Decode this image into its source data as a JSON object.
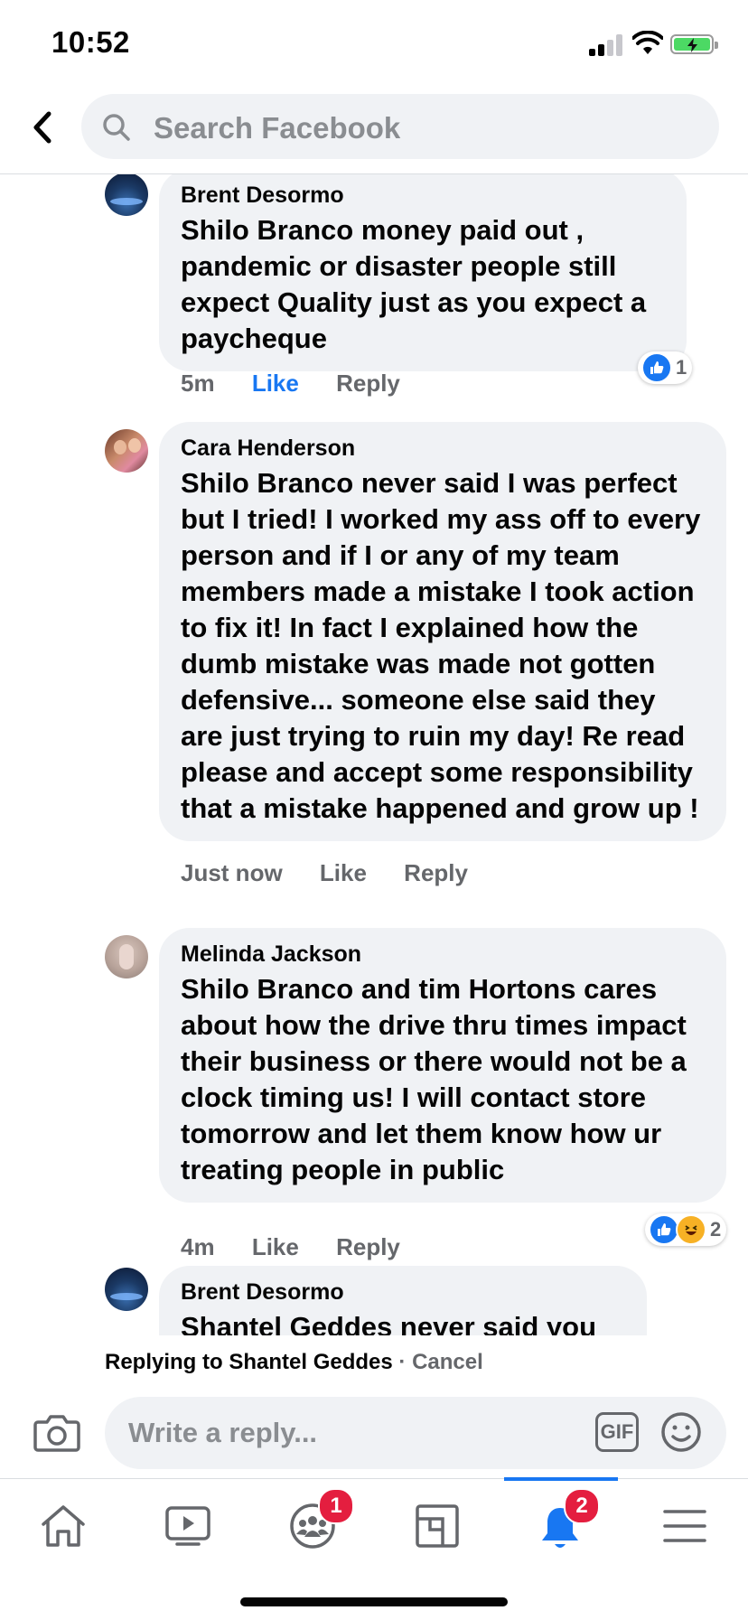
{
  "status_bar": {
    "time": "10:52"
  },
  "search": {
    "placeholder": "Search Facebook"
  },
  "comments": [
    {
      "author": "Brent Desormo",
      "mention": "Shilo Branco",
      "text": " money paid out , pandemic or disaster people still expect Quality just as you expect a paycheque",
      "time": "5m",
      "like_label": "Like",
      "reply_label": "Reply",
      "reaction_count": "1",
      "liked": true
    },
    {
      "author": "Cara Henderson",
      "mention": "Shilo Branco",
      "text": " never said I was perfect but I tried!  I worked my ass off to every person and if I or any of my team members made a mistake I took action to fix it! In fact I explained how the dumb mistake was made not gotten defensive... someone else said they are just trying to ruin my day!  Re read please and accept some responsibility that a mistake happened and grow up !",
      "time": "Just now",
      "like_label": "Like",
      "reply_label": "Reply"
    },
    {
      "author": "Melinda Jackson",
      "mention": "Shilo Branco",
      "text": " and tim Hortons cares about how the drive thru times impact their business or there would not be a clock timing us!  I will contact store tomorrow and let them know how ur treating people in public",
      "time": "4m",
      "like_label": "Like",
      "reply_label": "Reply",
      "reaction_count": "2"
    },
    {
      "author": "Brent Desormo",
      "mention": "Shantel Geddes",
      "text": " never said you"
    }
  ],
  "replying": {
    "prefix": "Replying to ",
    "name": "Shantel Geddes",
    "separator": " · ",
    "cancel": "Cancel"
  },
  "composer": {
    "placeholder": "Write a reply...",
    "gif_label": "GIF"
  },
  "tabs": {
    "groups_badge": "1",
    "notifications_badge": "2"
  },
  "colors": {
    "accent": "#1877f2",
    "bubble": "#f0f2f5",
    "badge": "#e41e3f"
  },
  "icons": [
    "back-icon",
    "search-icon",
    "camera-icon",
    "gif-icon",
    "emoji-icon",
    "home-icon",
    "watch-icon",
    "groups-icon",
    "pages-icon",
    "bell-icon",
    "menu-icon"
  ]
}
